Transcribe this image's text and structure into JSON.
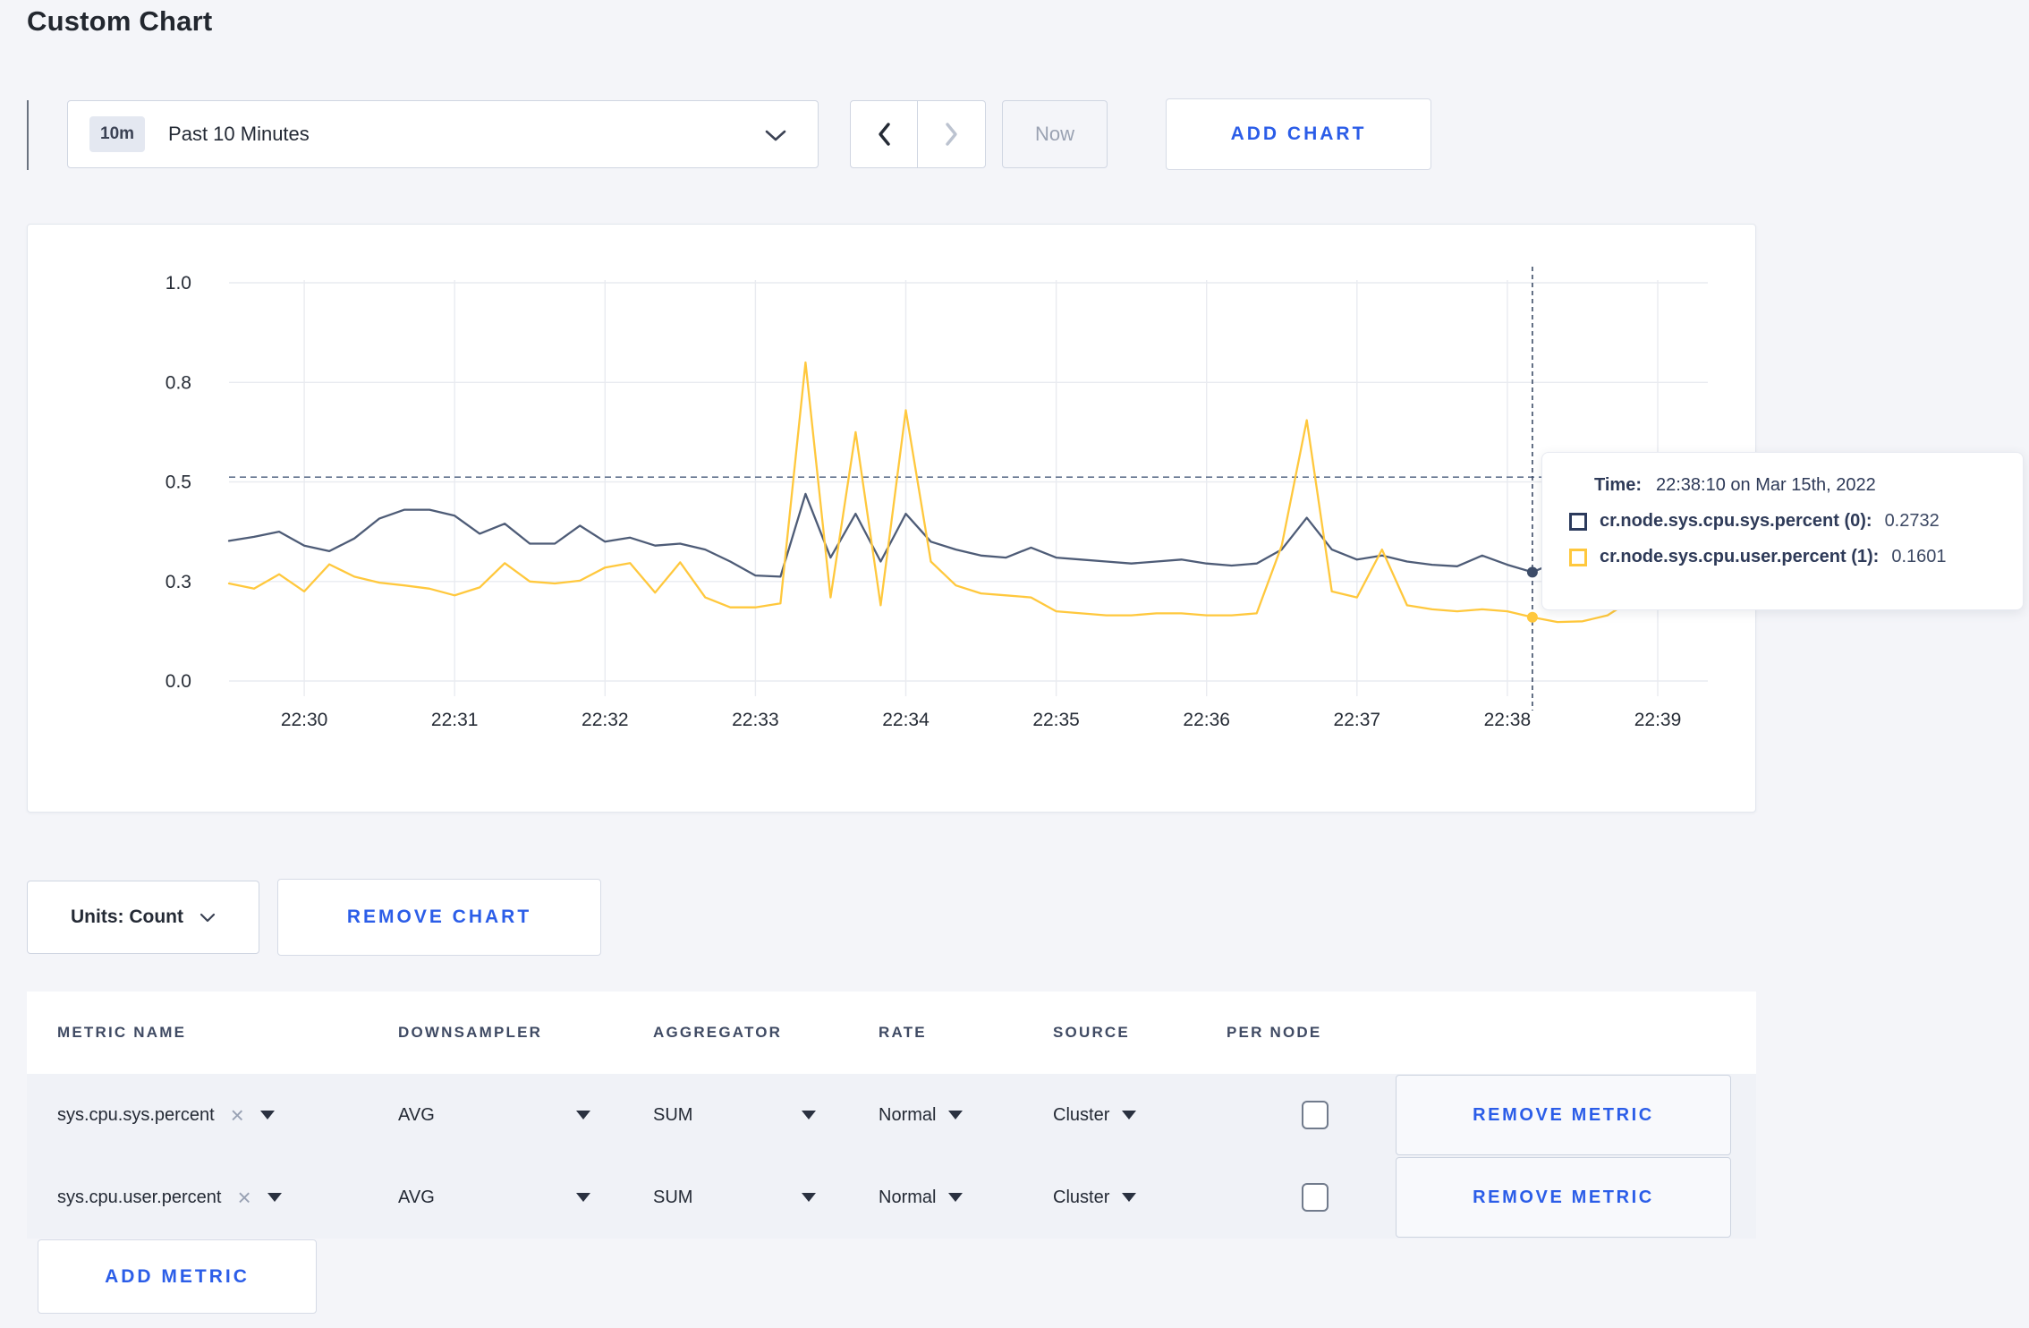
{
  "page": {
    "title": "Custom Chart"
  },
  "icons": {
    "remove_x": "×"
  },
  "toolbar": {
    "range_badge": "10m",
    "range_label": "Past 10 Minutes",
    "now_label": "Now",
    "add_chart_label": "ADD CHART"
  },
  "chart_data": {
    "type": "line",
    "title": "",
    "xlabel": "",
    "ylabel": "",
    "ylim": [
      0,
      1
    ],
    "grid": true,
    "legend_position": "tooltip",
    "y_ticks": [
      {
        "v": 0,
        "label": "0.0"
      },
      {
        "v": 0.25,
        "label": "0.3"
      },
      {
        "v": 0.5,
        "label": "0.5"
      },
      {
        "v": 0.75,
        "label": "0.8"
      },
      {
        "v": 1,
        "label": "1.0"
      }
    ],
    "x_tick_labels": [
      "22:30",
      "22:31",
      "22:32",
      "22:33",
      "22:34",
      "22:35",
      "22:36",
      "22:37",
      "22:38",
      "22:39"
    ],
    "max_line_value": 0.512,
    "crosshair": {
      "time": "22:38:10",
      "index": 52
    },
    "x": [
      "22:29:30",
      "22:29:40",
      "22:29:50",
      "22:30:00",
      "22:30:10",
      "22:30:20",
      "22:30:30",
      "22:30:40",
      "22:30:50",
      "22:31:00",
      "22:31:10",
      "22:31:20",
      "22:31:30",
      "22:31:40",
      "22:31:50",
      "22:32:00",
      "22:32:10",
      "22:32:20",
      "22:32:30",
      "22:32:40",
      "22:32:50",
      "22:33:00",
      "22:33:10",
      "22:33:20",
      "22:33:30",
      "22:33:40",
      "22:33:50",
      "22:34:00",
      "22:34:10",
      "22:34:20",
      "22:34:30",
      "22:34:40",
      "22:34:50",
      "22:35:00",
      "22:35:10",
      "22:35:20",
      "22:35:30",
      "22:35:40",
      "22:35:50",
      "22:36:00",
      "22:36:10",
      "22:36:20",
      "22:36:30",
      "22:36:40",
      "22:36:50",
      "22:37:00",
      "22:37:10",
      "22:37:20",
      "22:37:30",
      "22:37:40",
      "22:37:50",
      "22:38:00",
      "22:38:10",
      "22:38:20",
      "22:38:30",
      "22:38:40",
      "22:38:50",
      "22:39:00",
      "22:39:10",
      "22:39:20"
    ],
    "series": [
      {
        "name": "cr.node.sys.cpu.sys.percent",
        "color": "#4e5c77",
        "values": [
          0.352,
          0.362,
          0.375,
          0.34,
          0.326,
          0.358,
          0.408,
          0.43,
          0.43,
          0.415,
          0.37,
          0.395,
          0.345,
          0.345,
          0.39,
          0.35,
          0.36,
          0.34,
          0.345,
          0.33,
          0.3,
          0.265,
          0.262,
          0.47,
          0.31,
          0.42,
          0.3,
          0.42,
          0.35,
          0.33,
          0.315,
          0.31,
          0.335,
          0.31,
          0.305,
          0.3,
          0.295,
          0.3,
          0.305,
          0.295,
          0.29,
          0.295,
          0.33,
          0.41,
          0.33,
          0.305,
          0.315,
          0.3,
          0.292,
          0.288,
          0.315,
          0.292,
          0.2732,
          0.3,
          0.295,
          0.3,
          0.292,
          0.296,
          0.3,
          0.295
        ]
      },
      {
        "name": "cr.node.sys.cpu.user.percent",
        "color": "#ffc83d",
        "values": [
          0.245,
          0.232,
          0.268,
          0.225,
          0.293,
          0.262,
          0.247,
          0.24,
          0.232,
          0.215,
          0.235,
          0.296,
          0.25,
          0.245,
          0.252,
          0.285,
          0.296,
          0.222,
          0.298,
          0.21,
          0.185,
          0.185,
          0.195,
          0.8,
          0.21,
          0.625,
          0.19,
          0.68,
          0.3,
          0.24,
          0.22,
          0.215,
          0.21,
          0.175,
          0.17,
          0.165,
          0.165,
          0.17,
          0.17,
          0.165,
          0.165,
          0.17,
          0.34,
          0.655,
          0.225,
          0.21,
          0.33,
          0.19,
          0.18,
          0.175,
          0.18,
          0.175,
          0.1601,
          0.148,
          0.15,
          0.165,
          0.205,
          0.225,
          0.185,
          0.26
        ]
      }
    ]
  },
  "tooltip": {
    "time_label": "Time:",
    "time_value": "22:38:10 on Mar 15th, 2022",
    "rows": [
      {
        "label": "cr.node.sys.cpu.sys.percent (0):",
        "value": "0.2732",
        "color": "#2c3a5c"
      },
      {
        "label": "cr.node.sys.cpu.user.percent (1):",
        "value": "0.1601",
        "color": "#ffc83d"
      }
    ]
  },
  "chart_footer": {
    "units_label": "Units: Count",
    "remove_chart_label": "REMOVE CHART"
  },
  "metrics_table": {
    "headers": [
      "METRIC NAME",
      "DOWNSAMPLER",
      "AGGREGATOR",
      "RATE",
      "SOURCE",
      "PER NODE"
    ],
    "remove_metric_label": "REMOVE METRIC",
    "add_metric_label": "ADD METRIC",
    "rows": [
      {
        "metric": "sys.cpu.sys.percent",
        "downsampler": "AVG",
        "aggregator": "SUM",
        "rate": "Normal",
        "source": "Cluster",
        "per_node_checked": false
      },
      {
        "metric": "sys.cpu.user.percent",
        "downsampler": "AVG",
        "aggregator": "SUM",
        "rate": "Normal",
        "source": "Cluster",
        "per_node_checked": false
      }
    ]
  }
}
